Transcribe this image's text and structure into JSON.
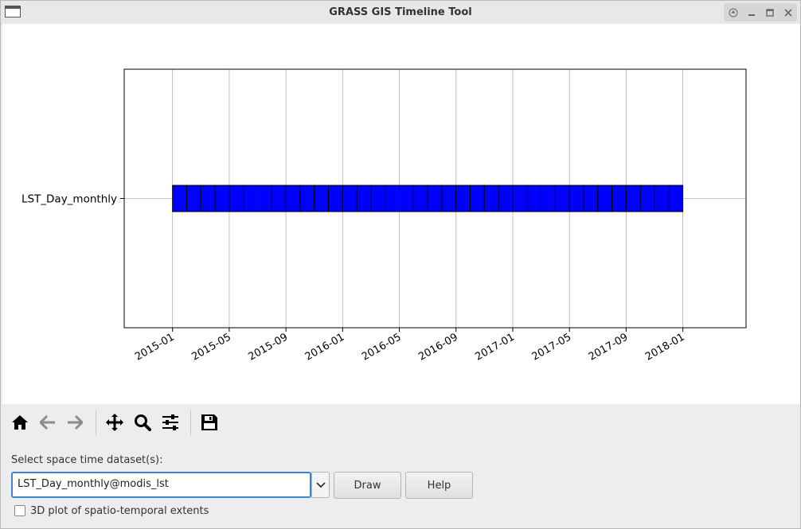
{
  "window": {
    "title": "GRASS GIS Timeline Tool",
    "controls": [
      "up-icon",
      "minimize-icon",
      "maximize-icon",
      "close-icon"
    ]
  },
  "chart_data": {
    "type": "timeline",
    "ytick_label": "LST_Day_monthly",
    "xtick_labels": [
      "2015-01",
      "2015-05",
      "2015-09",
      "2016-01",
      "2016-05",
      "2016-09",
      "2017-01",
      "2017-05",
      "2017-09",
      "2018-01"
    ],
    "series": [
      {
        "name": "LST_Day_monthly",
        "start": "2015-01",
        "end": "2018-01",
        "granularity": "1 month",
        "intervals": 36,
        "color": "#0000ff",
        "edge_color": "#000000"
      }
    ],
    "xlim": [
      "2014-09-19",
      "2018-05-15"
    ],
    "grid": "vertical"
  },
  "toolbar": {
    "icons": [
      "home-icon",
      "back-icon",
      "forward-icon",
      "pan-icon",
      "zoom-icon",
      "configure-subplots-icon",
      "save-icon"
    ]
  },
  "dataset": {
    "label": "Select space time dataset(s):",
    "value": "LST_Day_monthly@modis_lst"
  },
  "buttons": {
    "draw": "Draw",
    "help": "Help"
  },
  "options": {
    "plot3d_label": "3D plot of spatio-temporal extents",
    "plot3d_checked": false
  }
}
